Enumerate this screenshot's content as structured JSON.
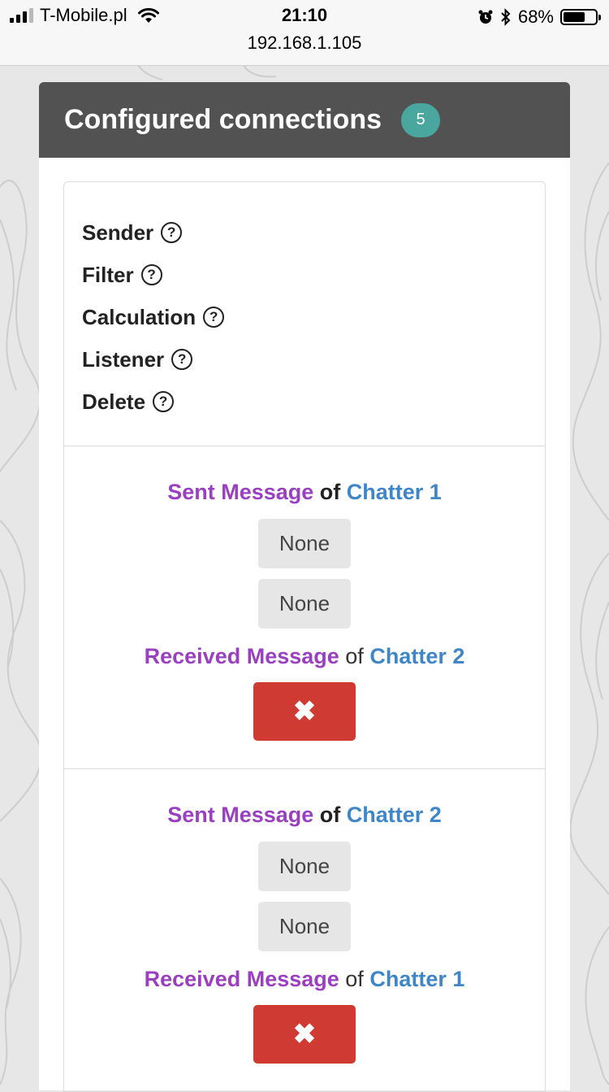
{
  "status_bar": {
    "carrier": "T-Mobile.pl",
    "time": "21:10",
    "url": "192.168.1.105",
    "battery_percent": "68%",
    "battery_level": 0.68
  },
  "panel": {
    "title": "Configured connections",
    "count": "5",
    "header_color": "#525252",
    "badge_color": "#4aa7a0"
  },
  "legend": {
    "items": [
      "Sender",
      "Filter",
      "Calculation",
      "Listener",
      "Delete"
    ],
    "help_icon": "question-circle-icon"
  },
  "connections": [
    {
      "sender_message": "Sent Message",
      "sender_of": "of",
      "sender_chatter": "Chatter 1",
      "filter": "None",
      "calculation": "None",
      "listener_message": "Received Message",
      "listener_of": "of",
      "listener_chatter": "Chatter 2",
      "delete_icon": "✖"
    },
    {
      "sender_message": "Sent Message",
      "sender_of": "of",
      "sender_chatter": "Chatter 2",
      "filter": "None",
      "calculation": "None",
      "listener_message": "Received Message",
      "listener_of": "of",
      "listener_chatter": "Chatter 1",
      "delete_icon": "✖"
    }
  ],
  "colors": {
    "message": "#9b3fc1",
    "chatter": "#3f86c9",
    "delete": "#cf3a32"
  }
}
